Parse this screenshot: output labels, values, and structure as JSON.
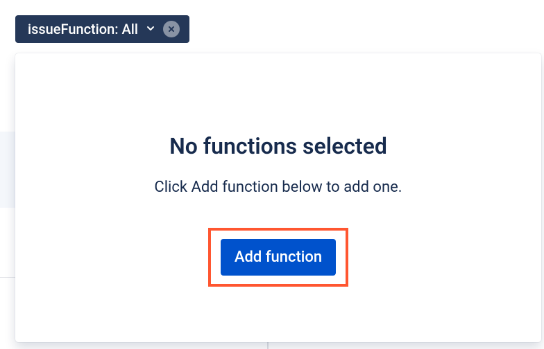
{
  "filter": {
    "label": "issueFunction: All"
  },
  "panel": {
    "title": "No functions selected",
    "subtitle": "Click Add function below to add one.",
    "add_button": "Add function"
  }
}
